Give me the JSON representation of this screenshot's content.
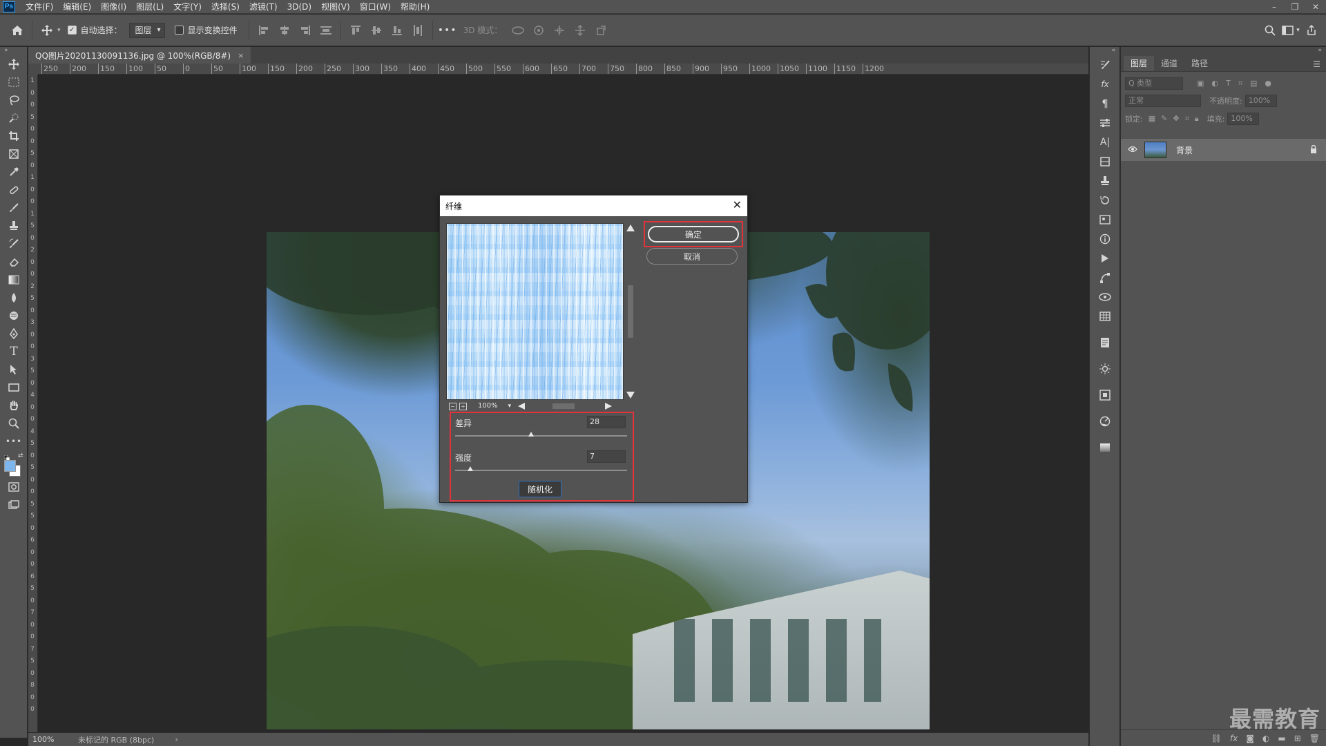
{
  "menu": {
    "logo": "Ps",
    "items": [
      "文件(F)",
      "编辑(E)",
      "图像(I)",
      "图层(L)",
      "文字(Y)",
      "选择(S)",
      "滤镜(T)",
      "3D(D)",
      "视图(V)",
      "窗口(W)",
      "帮助(H)"
    ]
  },
  "options": {
    "auto_select_label": "自动选择：",
    "auto_select_checked": true,
    "layer_select_value": "图层",
    "show_transform_label": "显示变换控件",
    "mode_3d_label": "3D 模式："
  },
  "document": {
    "tab_title": "QQ图片20201130091136.jpg @ 100%(RGB/8#)",
    "close_glyph": "×"
  },
  "ruler": {
    "h_labels": [
      "250",
      "200",
      "150",
      "100",
      "50",
      "0",
      "50",
      "100",
      "150",
      "200",
      "250",
      "300",
      "350",
      "400",
      "450",
      "500",
      "550",
      "600",
      "650",
      "700",
      "750",
      "800",
      "850",
      "900",
      "950",
      "1000",
      "1050",
      "1100",
      "1150",
      "1200"
    ],
    "v_labels": [
      "1",
      "0",
      "0",
      "5",
      "0",
      "0",
      "5",
      "0",
      "1",
      "0",
      "0",
      "1",
      "5",
      "0",
      "2",
      "0",
      "0",
      "2",
      "5",
      "0",
      "3",
      "0",
      "0",
      "3",
      "5",
      "0",
      "4",
      "0",
      "0",
      "4",
      "5",
      "0",
      "5",
      "0",
      "0",
      "5",
      "5",
      "0",
      "6",
      "0",
      "0",
      "6",
      "5",
      "0",
      "7",
      "0",
      "0",
      "7",
      "5",
      "0",
      "8",
      "0",
      "0"
    ]
  },
  "dialog": {
    "title": "纤维",
    "close_glyph": "✕",
    "ok_label": "确定",
    "cancel_label": "取消",
    "zoom_value": "100%",
    "variance_label": "差异",
    "variance_value": "28",
    "variance_ratio": 0.44,
    "strength_label": "强度",
    "strength_value": "7",
    "strength_ratio": 0.09,
    "randomize_label": "随机化"
  },
  "layers_panel": {
    "tabs": [
      "图层",
      "通道",
      "路径"
    ],
    "active_tab": 0,
    "kind_placeholder": "Q 类型",
    "blend_mode": "正常",
    "opacity_label": "不透明度:",
    "opacity_value": "100%",
    "lock_label": "锁定:",
    "fill_label": "填充:",
    "fill_value": "100%",
    "layer_name": "背景"
  },
  "status": {
    "zoom": "100%",
    "info": "未标记的 RGB (8bpc)",
    "arrow": "›"
  },
  "watermark": "最需教育"
}
